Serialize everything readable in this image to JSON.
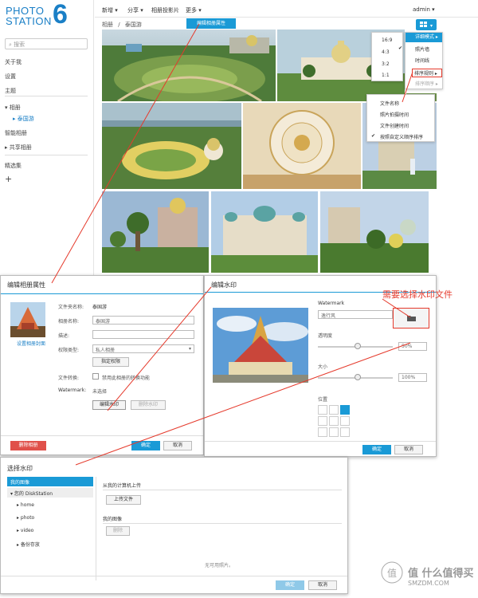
{
  "app": {
    "logo_text": "PHOTO\nSTATION",
    "logo_number": "6"
  },
  "sidebar": {
    "search_placeholder": "搜索",
    "items": [
      {
        "label": "关于我"
      },
      {
        "label": "设置"
      },
      {
        "label": "主题"
      },
      {
        "label": "相册"
      },
      {
        "label": "泰国游"
      },
      {
        "label": "智能相册"
      },
      {
        "label": "共享相册"
      },
      {
        "label": "精选集"
      },
      {
        "label": "+"
      }
    ]
  },
  "topbar": {
    "new": "新增 ▾",
    "share": "分享 ▾",
    "slideshow": "相册投影片",
    "more": "更多 ▾",
    "user": "admin ▾"
  },
  "breadcrumb": {
    "root": "相册",
    "sep": "/",
    "current": "泰国游"
  },
  "edit_button": "编辑相册属性",
  "view_menu": {
    "ratios": [
      "16:9",
      "4:3",
      "3:2",
      "1:1"
    ],
    "items": [
      "详细模式",
      "照片墙",
      "时间线",
      "排序规则",
      "排序顺序"
    ],
    "sort_items": [
      "文件名称",
      "照片拍摄时间",
      "文件创建时间",
      "按照自定义顺序排序"
    ]
  },
  "album_dialog": {
    "title": "编辑相册属性",
    "cover_label": "设置相册封面",
    "folder_label": "文件夹名称:",
    "folder_value": "泰国游",
    "album_label": "相册名称:",
    "album_value": "泰国游",
    "desc_label": "描述:",
    "perm_label": "权限类型:",
    "perm_value": "私人相册",
    "perm_button": "指定权限",
    "convert_label": "文件转换:",
    "convert_check": "禁用此相册的转换功能",
    "wm_label": "Watermark:",
    "wm_value": "未选择",
    "wm_edit": "编辑水印",
    "wm_delete": "删除水印",
    "delete_album": "删除相册",
    "ok": "确定",
    "cancel": "取消"
  },
  "watermark_dialog": {
    "title": "编辑水印",
    "wm_label": "Watermark",
    "wm_value": "逸行风",
    "opacity_label": "透明度",
    "opacity_value": "50%",
    "size_label": "大小",
    "size_value": "100%",
    "pos_label": "位置",
    "ok": "确定",
    "cancel": "取消"
  },
  "annotation": "需要选择水印文件",
  "select_dialog": {
    "title": "选择水印",
    "tree": [
      "我的图像",
      "您的 DiskStation",
      "home",
      "photo",
      "video",
      "备份存放"
    ],
    "upload_header": "从我的计算机上传",
    "upload_button": "上传文件",
    "my_images_header": "我的图像",
    "delete_button": "删除",
    "empty": "无可用照片。",
    "ok": "确定",
    "cancel": "取消"
  },
  "watermark_site": "值 什么值得买",
  "watermark_site2": "SMZDM.COM",
  "colors": {
    "accent": "#1a9ad6",
    "annotation": "#e53a2c"
  }
}
